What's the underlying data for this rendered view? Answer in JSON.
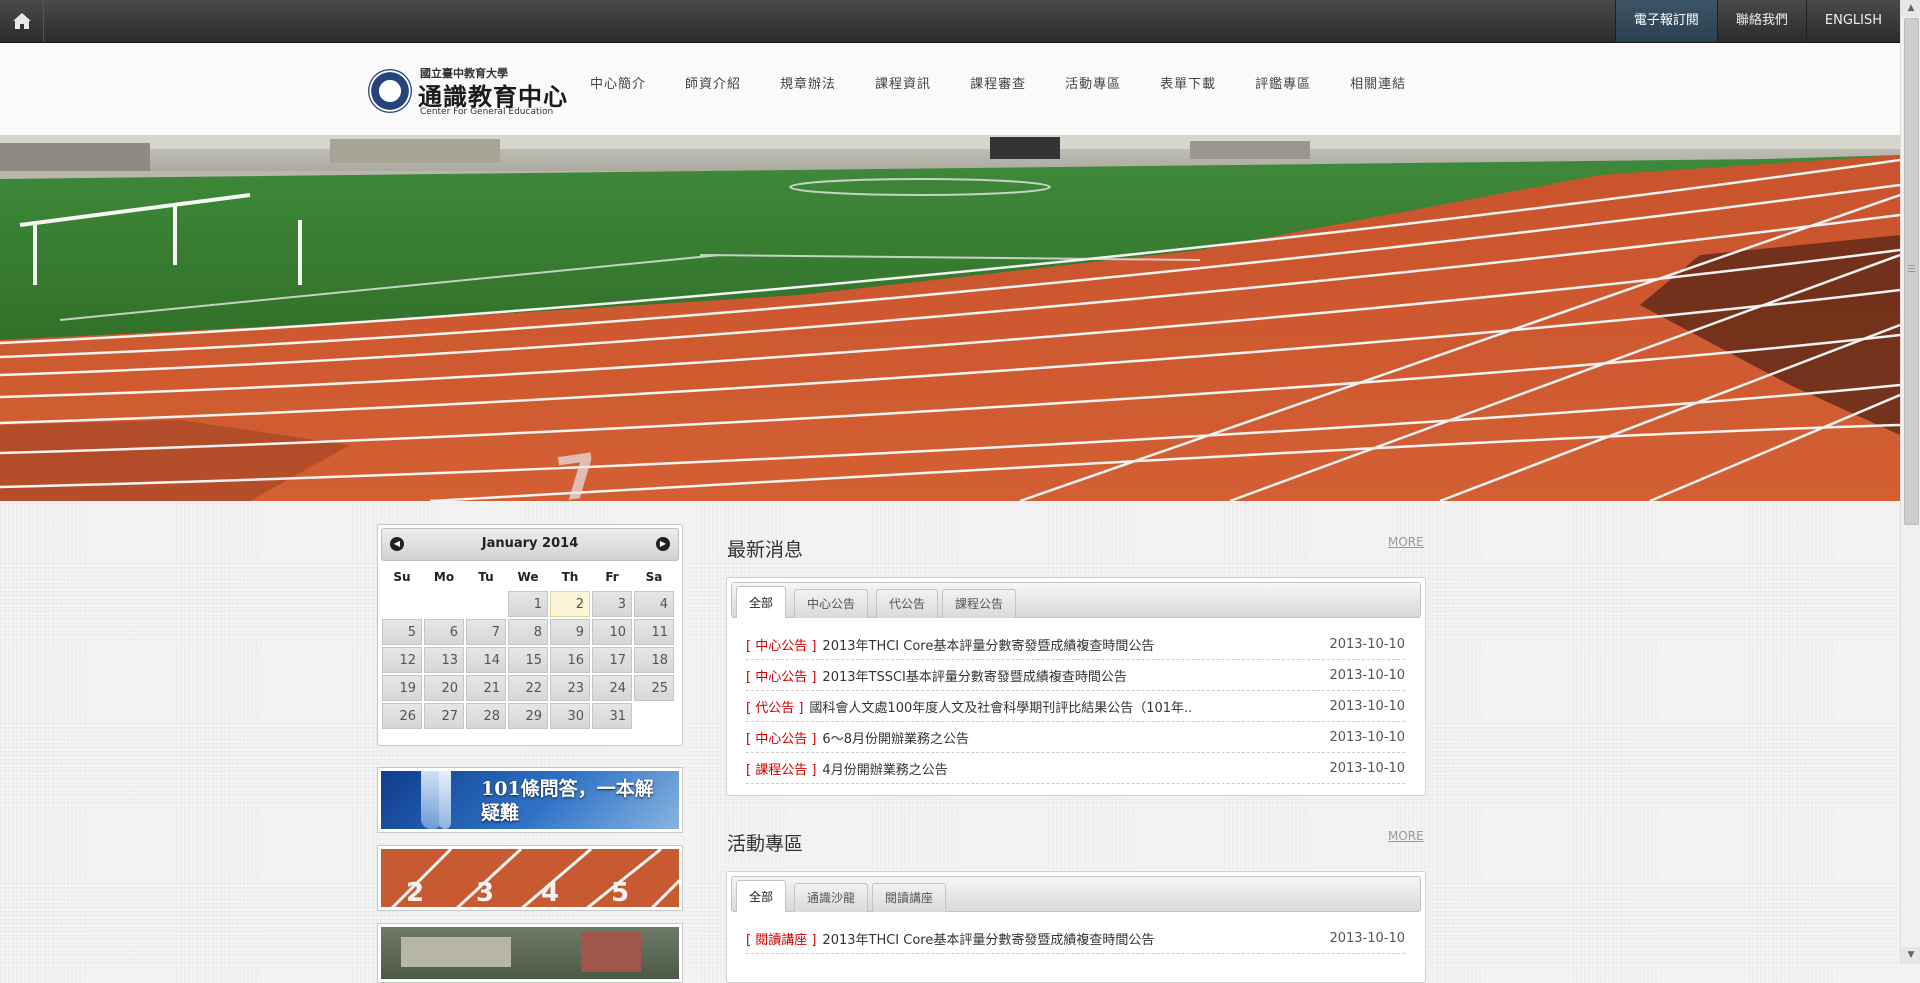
{
  "topbar": {
    "home_icon": "home-icon",
    "links": [
      {
        "label": "電子報訂閱",
        "active": true
      },
      {
        "label": "聯絡我們",
        "active": false
      },
      {
        "label": "ENGLISH",
        "active": false
      }
    ]
  },
  "header": {
    "logo_small": "國立臺中教育大學",
    "logo_main": "通識教育中心",
    "logo_en": "Center For General Education",
    "nav": [
      "中心簡介",
      "師資介紹",
      "規章辦法",
      "課程資訊",
      "課程審查",
      "活動專區",
      "表單下載",
      "評鑑專區",
      "相關連結"
    ]
  },
  "calendar": {
    "title": "January 2014",
    "prev_icon": "arrow-left-icon",
    "next_icon": "arrow-right-icon",
    "weekdays": [
      "Su",
      "Mo",
      "Tu",
      "We",
      "Th",
      "Fr",
      "Sa"
    ],
    "days": [
      "1",
      "2",
      "3",
      "4",
      "5",
      "6",
      "7",
      "8",
      "9",
      "10",
      "11",
      "12",
      "13",
      "14",
      "15",
      "16",
      "17",
      "18",
      "19",
      "20",
      "21",
      "22",
      "23",
      "24",
      "25",
      "26",
      "27",
      "28",
      "29",
      "30",
      "31"
    ],
    "today": "2"
  },
  "side_banners": {
    "qa_text": "101條問答，一本解疑難",
    "track_numbers": [
      "2",
      "3",
      "4",
      "5"
    ]
  },
  "news": {
    "title": "最新消息",
    "more": "MORE",
    "tabs": [
      "全部",
      "中心公告",
      "代公告",
      "課程公告"
    ],
    "items": [
      {
        "cat": "[ 中心公告 ]",
        "title": "2013年THCI Core基本評量分數寄發暨成績複查時間公告",
        "date": "2013-10-10"
      },
      {
        "cat": "[ 中心公告 ]",
        "title": "2013年TSSCI基本評量分數寄發暨成績複查時間公告",
        "date": "2013-10-10"
      },
      {
        "cat": "[ 代公告 ]",
        "title": "國科會人文處100年度人文及社會科學期刊評比結果公告（101年..",
        "date": "2013-10-10"
      },
      {
        "cat": "[ 中心公告 ]",
        "title": "6～8月份開辦業務之公告",
        "date": "2013-10-10"
      },
      {
        "cat": "[ 課程公告 ]",
        "title": "4月份開辦業務之公告",
        "date": "2013-10-10"
      }
    ]
  },
  "activities": {
    "title": "活動專區",
    "more": "MORE",
    "tabs": [
      "全部",
      "通識沙龍",
      "閱讀講座"
    ],
    "items": [
      {
        "cat": "[ 閱讀講座 ]",
        "title": "2013年THCI Core基本評量分數寄發暨成績複查時間公告",
        "date": "2013-10-10"
      }
    ]
  },
  "colors": {
    "accent_red": "#d10000",
    "topbar": "#333333",
    "active_link": "#35505f"
  }
}
